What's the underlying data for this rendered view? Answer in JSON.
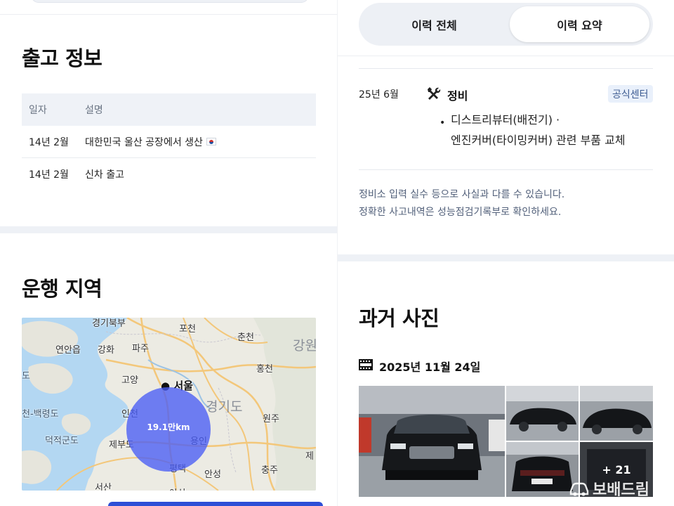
{
  "left": {
    "shipping": {
      "title": "출고 정보",
      "columns": [
        "일자",
        "설명"
      ],
      "rows": [
        {
          "date": "14년 2월",
          "desc": "대한민국 울산 공장에서 생산"
        },
        {
          "date": "14년 2월",
          "desc": "신차 출고"
        }
      ],
      "flag_icon": "korea-flag-icon"
    },
    "region": {
      "title": "운행 지역",
      "radius_label": "19.1만km",
      "map_labels": {
        "gyeonggi_top": "경기북부",
        "pocheon": "포천",
        "chuncheon": "춘천",
        "gangwon": "강원",
        "yeonan": "연안읍",
        "ganghwa": "강화",
        "paju": "파주",
        "hongcheon": "홍천",
        "goyang": "고양",
        "seoul": "서울",
        "do": "도",
        "gyeonggi": "경기도",
        "incheon": "인천",
        "baengnyeong": "천-백령도",
        "wonju": "원주",
        "deokjeok": "덕적군도",
        "jebu": "제부도",
        "yongin": "용인",
        "je": "제",
        "pyeongtaek": "평택",
        "anseong": "안성",
        "chungju": "충주",
        "seosan": "서산",
        "asan": "아산"
      }
    }
  },
  "right": {
    "tabs": {
      "all": "이력 전체",
      "summary": "이력 요약"
    },
    "history": {
      "date": "25년 6월",
      "type": "정비",
      "badge": "공식센터",
      "line1": "디스트리뷰터(배전기) ·",
      "line2": "엔진커버(타이밍커버) 관련 부품 교체",
      "type_icon": "wrench-screwdriver-icon"
    },
    "notes": {
      "line1": "정비소 입력 실수 등으로 사실과 다를 수 있습니다.",
      "line2": "정확한 사고내역은 성능점검기록부로 확인하세요."
    },
    "photos": {
      "title": "과거 사진",
      "date": "2025년 11월 24일",
      "more": "+ 21",
      "date_icon": "film-icon"
    }
  },
  "watermark": "보배드림",
  "colors": {
    "accent_blue": "#495cf5",
    "badge_bg": "#e9f0fb",
    "badge_text": "#3f5d92",
    "table_head_bg": "#eff2f7",
    "segment_bg": "#edf0f5"
  }
}
